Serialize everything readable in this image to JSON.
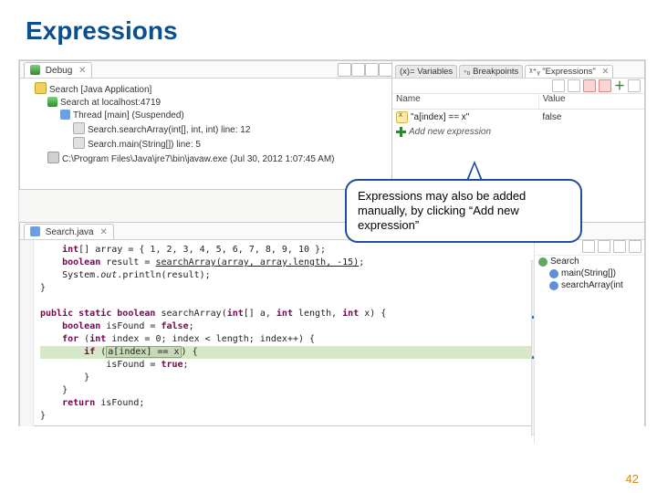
{
  "slide": {
    "title": "Expressions",
    "page_number": "42"
  },
  "debug_view": {
    "tab_label": "Debug",
    "items": {
      "launch": "Search [Java Application]",
      "vm": "Search at localhost:4719",
      "thread": "Thread [main] (Suspended)",
      "frame0": "Search.searchArray(int[], int, int) line: 12",
      "frame1": "Search.main(String[]) line: 5",
      "process": "C:\\Program Files\\Java\\jre7\\bin\\javaw.exe (Jul 30, 2012 1:07:45 AM)"
    }
  },
  "right_view": {
    "tabs": {
      "variables": "(x)= Variables",
      "breakpoints": "◦₀ Breakpoints",
      "expressions": "ᵡ⁺ᵧ \"Expressions\""
    },
    "columns": {
      "name": "Name",
      "value": "Value"
    },
    "rows": [
      {
        "name": "\"a[index] == x\"",
        "value": "false"
      },
      {
        "name": "Add new expression",
        "value": ""
      }
    ]
  },
  "editor": {
    "tab_label": "Search.java",
    "lines": {
      "l1": "int[] array = { 1, 2, 3, 4, 5, 6, 7, 8, 9, 10 };",
      "l2a": "boolean result = ",
      "l2b": "searchArray(array, array.length, -15)",
      "l2c": ";",
      "l3_pre": "System.out.println(",
      "l3_arg": "result",
      "l3_post": ");",
      "l4": "}",
      "l5a": "public static boolean ",
      "l5b": "searchArray",
      "l5c": "(int[] a, int length, int x) {",
      "l6a": "boolean isFound = ",
      "l6b": "false",
      "l6c": ";",
      "l7a": "for (int index = 0; index < length; index++) {",
      "l8a": "if (",
      "l8b": "a[index] == x",
      "l8c": ") {",
      "l9a": "isFound = ",
      "l9b": "true",
      "l9c": ";",
      "l10": "}",
      "l11": "}",
      "l12a": "return",
      "l12b": " isFound;",
      "l13": "}"
    },
    "outline": {
      "class": "Search",
      "m1": "main(String[])",
      "m2": "searchArray(int"
    }
  },
  "callout": {
    "text": "Expressions may also be added manually, by clicking “Add new expression”"
  }
}
